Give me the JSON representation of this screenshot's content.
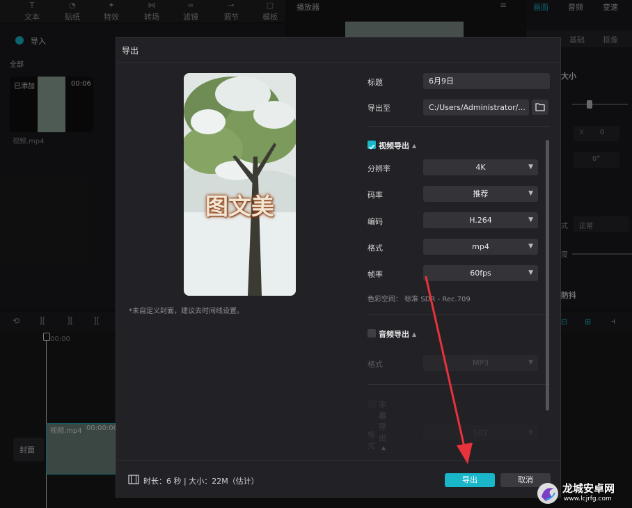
{
  "toolbar": {
    "items": [
      "文本",
      "贴纸",
      "特效",
      "转场",
      "滤镜",
      "调节",
      "模板"
    ]
  },
  "media": {
    "import_label": "导入",
    "all_label": "全部",
    "added_label": "已添加",
    "clip_duration": "00:06",
    "clip_name": "视频.mp4"
  },
  "player": {
    "title": "播放器"
  },
  "right_panel": {
    "tabs": [
      "画面",
      "音频",
      "变速"
    ],
    "subtabs": [
      "基础",
      "抠像"
    ],
    "size_label": "大小",
    "x_label": "X",
    "x_value": "0",
    "rotation": "0°",
    "blend_label": "式",
    "blend_value": "正常",
    "opacity_label": "度",
    "stabilize_label": "防抖"
  },
  "timeline": {
    "time_start": "00:00",
    "cover_label": "封面",
    "track_clip_name": "视频.mp4",
    "track_clip_duration": "00:00:06:"
  },
  "dialog": {
    "title": "导出",
    "cover_text": "图文美",
    "hint": "*未自定义封面，建议去时间线设置。",
    "title_label": "标题",
    "title_value": "6月9日",
    "export_to_label": "导出至",
    "export_path": "C:/Users/Administrator/...",
    "video_section": "视频导出",
    "resolution_label": "分辨率",
    "resolution_value": "4K",
    "bitrate_label": "码率",
    "bitrate_value": "推荐",
    "codec_label": "编码",
    "codec_value": "H.264",
    "format_label": "格式",
    "format_value": "mp4",
    "fps_label": "帧率",
    "fps_value": "60fps",
    "color_space": "色彩空间：  标准 SDR - Rec.709",
    "audio_section": "音频导出",
    "audio_format_label": "格式",
    "audio_format_value": "MP3",
    "subtitle_section": "字幕导出",
    "subtitle_format_label": "格式",
    "subtitle_format_value": "SRT",
    "footer_info": "时长：6 秒 | 大小：22M（估计）",
    "export_button": "导出",
    "cancel_button": "取消"
  },
  "watermark": {
    "name": "龙城安卓网",
    "url": "www.lcjrfg.com"
  },
  "colors": {
    "accent": "#19b7c9",
    "dialog_bg": "#222226",
    "annotation": "#e8323c"
  }
}
